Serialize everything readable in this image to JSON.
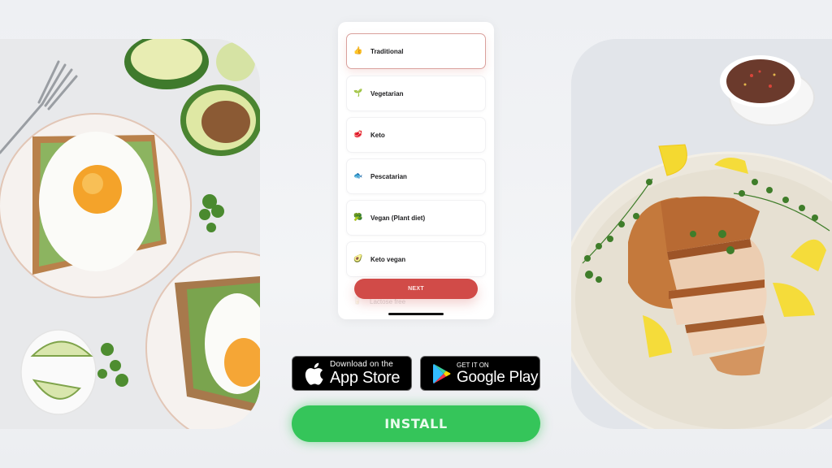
{
  "images": {
    "left": {
      "subject": "avocado toast with fried egg"
    },
    "right": {
      "subject": "grilled chicken breast with lemon and herbs"
    }
  },
  "phone": {
    "options": [
      {
        "label": "Traditional",
        "icon": "thumbs-up-icon",
        "glyph": "👍",
        "selected": true
      },
      {
        "label": "Vegetarian",
        "icon": "seedling-icon",
        "glyph": "🌱",
        "selected": false
      },
      {
        "label": "Keto",
        "icon": "meat-icon",
        "glyph": "🥩",
        "selected": false
      },
      {
        "label": "Pescatarian",
        "icon": "fish-icon",
        "glyph": "🐟",
        "selected": false
      },
      {
        "label": "Vegan (Plant diet)",
        "icon": "broccoli-icon",
        "glyph": "🥦",
        "selected": false
      },
      {
        "label": "Keto vegan",
        "icon": "avocado-icon",
        "glyph": "🥑",
        "selected": false
      },
      {
        "label": "Lactose free",
        "icon": "milk-icon",
        "glyph": "🥛",
        "selected": false
      }
    ],
    "next_label": "NEXT"
  },
  "badges": {
    "appstore": {
      "small": "Download on the",
      "big": "App Store"
    },
    "google": {
      "small": "GET IT ON",
      "big": "Google Play"
    }
  },
  "install_label": "INSTALL",
  "colors": {
    "accent_red": "#d14b48",
    "install_green": "#35c55a",
    "background": "#f0f1f3"
  }
}
